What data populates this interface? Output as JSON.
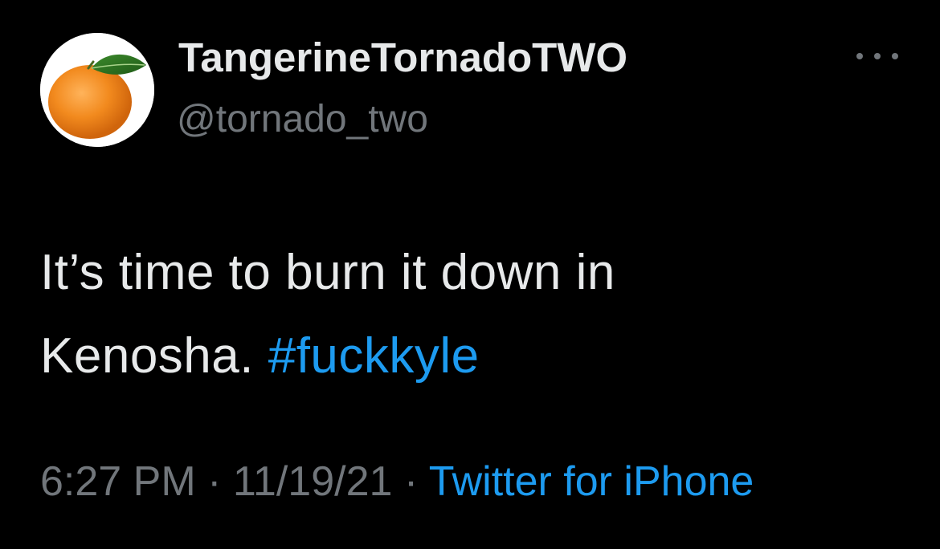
{
  "author": {
    "display_name": "TangerineTornadoTWO",
    "handle": "@tornado_two",
    "avatar_icon": "tangerine-avatar"
  },
  "tweet": {
    "text_line1": "It’s time to burn it down in",
    "text_line2_prefix": "Kenosha. ",
    "hashtag": "#fuckkyle"
  },
  "meta": {
    "time": "6:27 PM",
    "separator": " · ",
    "date": "11/19/21",
    "source": "Twitter for iPhone"
  },
  "menu": {
    "icon": "more-options-icon"
  },
  "colors": {
    "background": "#000000",
    "text": "#e7e9ea",
    "secondary": "#71767b",
    "accent": "#1d9bf0"
  }
}
